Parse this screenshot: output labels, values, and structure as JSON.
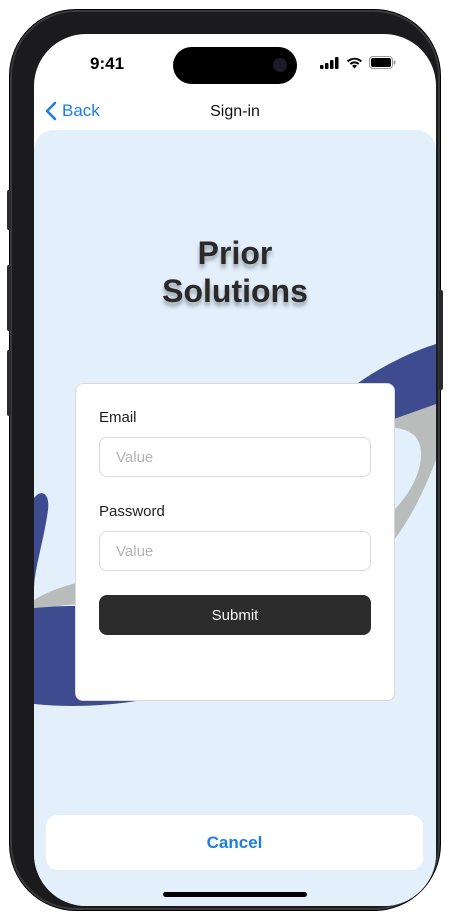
{
  "status_bar": {
    "time": "9:41",
    "icons": [
      "signal-icon",
      "wifi-icon",
      "battery-icon"
    ]
  },
  "nav": {
    "back_label": "Back",
    "title": "Sign-in"
  },
  "brand": {
    "line1": "Prior",
    "line2": "Solutions"
  },
  "form": {
    "email_label": "Email",
    "email_placeholder": "Value",
    "email_value": "",
    "password_label": "Password",
    "password_placeholder": "Value",
    "password_value": "",
    "submit_label": "Submit"
  },
  "cancel_label": "Cancel",
  "colors": {
    "accent": "#1a7fe0",
    "background": "#e3f0fc",
    "blob_blue": "#3f4b8f",
    "blob_gray": "#b8bcbb",
    "button_dark": "#2c2c2c"
  }
}
